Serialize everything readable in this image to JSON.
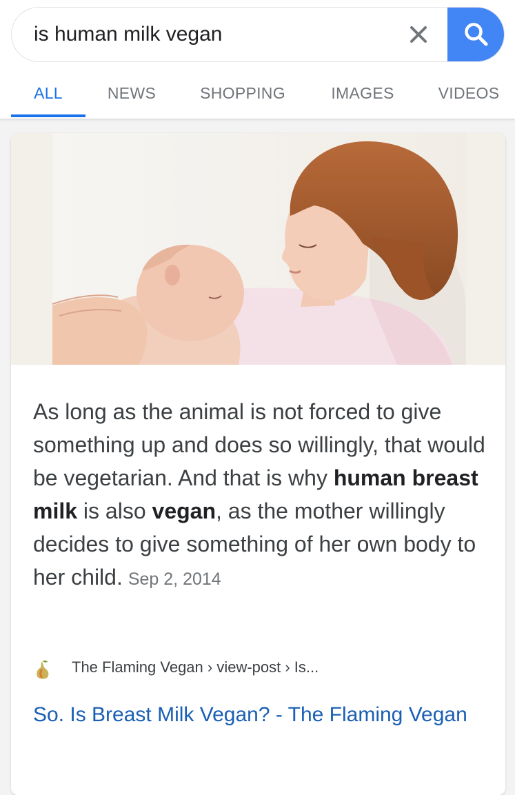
{
  "search": {
    "query": "is human milk vegan",
    "clear_icon": "close-icon",
    "submit_icon": "search-icon",
    "accent_color": "#4285f4"
  },
  "tabs": [
    {
      "label": "ALL",
      "active": true
    },
    {
      "label": "NEWS",
      "active": false
    },
    {
      "label": "SHOPPING",
      "active": false
    },
    {
      "label": "IMAGES",
      "active": false
    },
    {
      "label": "VIDEOS",
      "active": false
    }
  ],
  "result": {
    "snippet": {
      "t1": "As long as the animal is not forced to give something up and does so willingly, that would be vegetarian. And that is why ",
      "b1": "human breast milk",
      "t2": " is also ",
      "b2": "vegan",
      "t3": ", as the mother willingly decides to give something of her own body to her child.",
      "date": "Sep 2, 2014"
    },
    "source": {
      "breadcrumb": "The Flaming Vegan › view-post › Is...",
      "favicon": "pear-icon"
    },
    "title": "So. Is Breast Milk Vegan? - The Flaming Vegan",
    "link_color": "#1a5fb4"
  }
}
